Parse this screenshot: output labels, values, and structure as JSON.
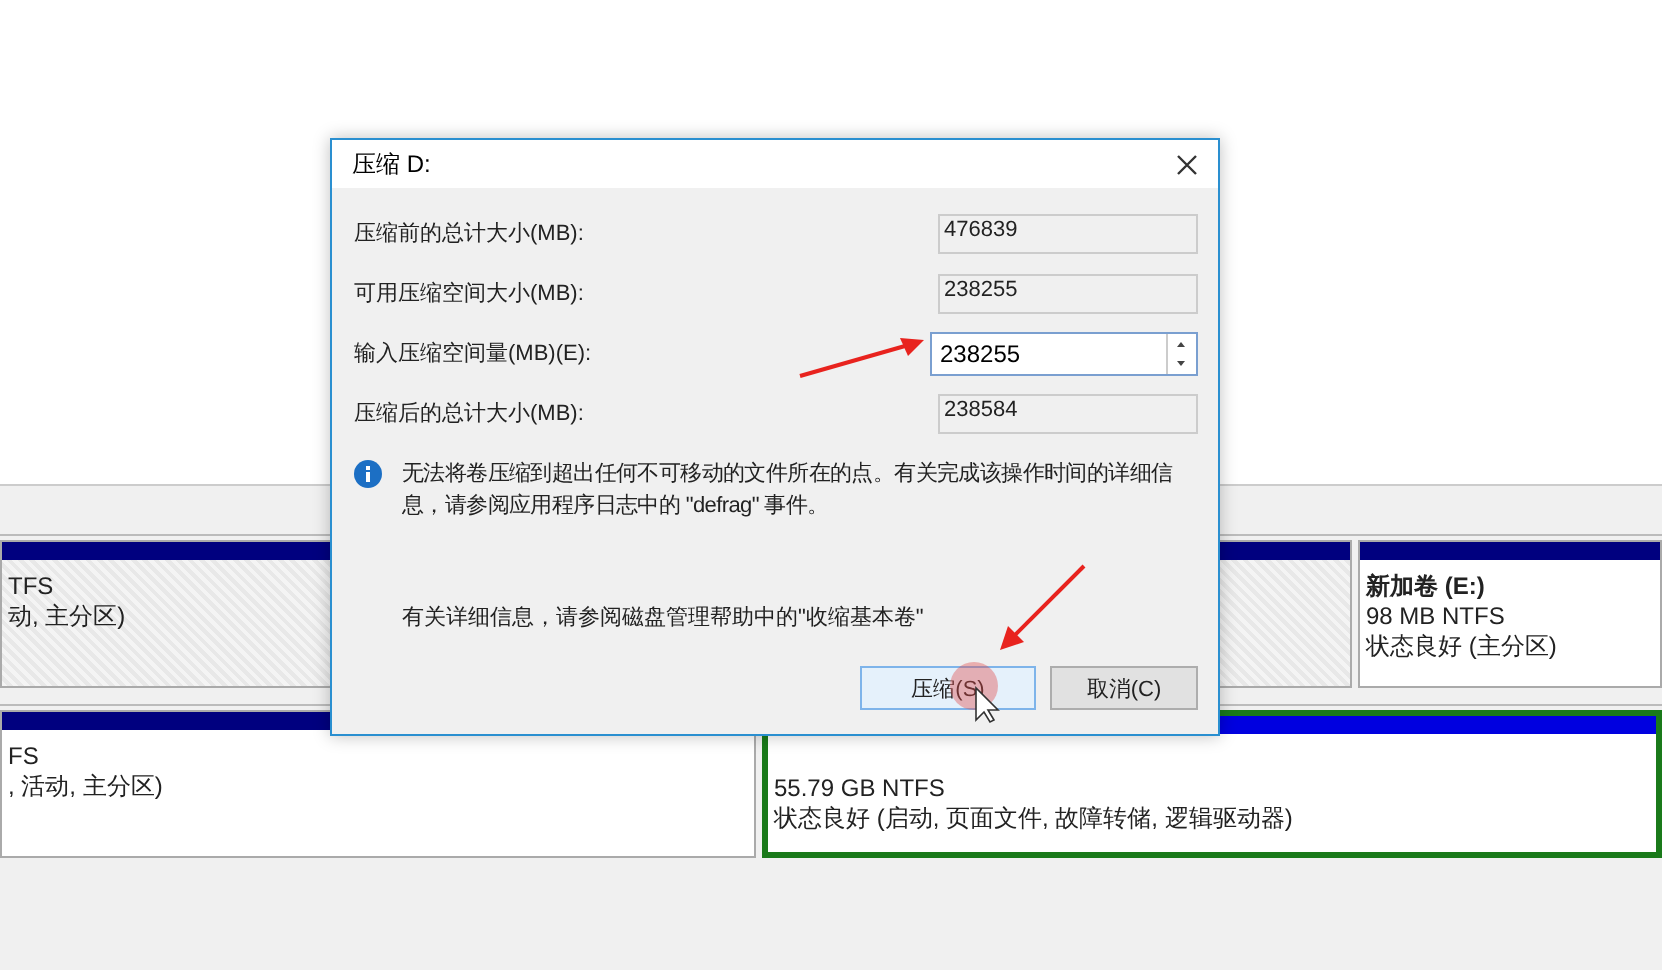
{
  "disks": [
    {
      "partitions": [
        {
          "kind": "hatched",
          "lines": [
            "TFS",
            "动, 主分区)"
          ]
        },
        {
          "kind": "hatched"
        },
        {
          "kind": "plain",
          "name": "新加卷  (E:)",
          "lines": [
            "98 MB NTFS",
            "状态良好 (主分区)"
          ]
        }
      ]
    },
    {
      "partitions": [
        {
          "kind": "plain",
          "lines": [
            "FS",
            ", 活动, 主分区)"
          ]
        },
        {
          "kind": "selected",
          "lines": [
            "55.79 GB NTFS",
            "状态良好 (启动, 页面文件, 故障转储, 逻辑驱动器)"
          ]
        }
      ]
    }
  ],
  "dialog": {
    "title": "压缩 D:",
    "fields": [
      {
        "label": "压缩前的总计大小(MB):",
        "value": "476839",
        "kind": "readonly"
      },
      {
        "label": "可用压缩空间大小(MB):",
        "value": "238255",
        "kind": "readonly"
      },
      {
        "label": "输入压缩空间量(MB)(E):",
        "value": "238255",
        "kind": "spinner"
      },
      {
        "label": "压缩后的总计大小(MB):",
        "value": "238584",
        "kind": "readonly"
      }
    ],
    "info": "无法将卷压缩到超出任何不可移动的文件所在的点。有关完成该操作时间的详细信息，请参阅应用程序日志中的 \"defrag\" 事件。",
    "help": "有关详细信息，请参阅磁盘管理帮助中的\"收缩基本卷\"",
    "buttons": [
      {
        "label": "压缩(S)",
        "focused": true
      },
      {
        "label": "取消(C)",
        "focused": false
      }
    ]
  }
}
